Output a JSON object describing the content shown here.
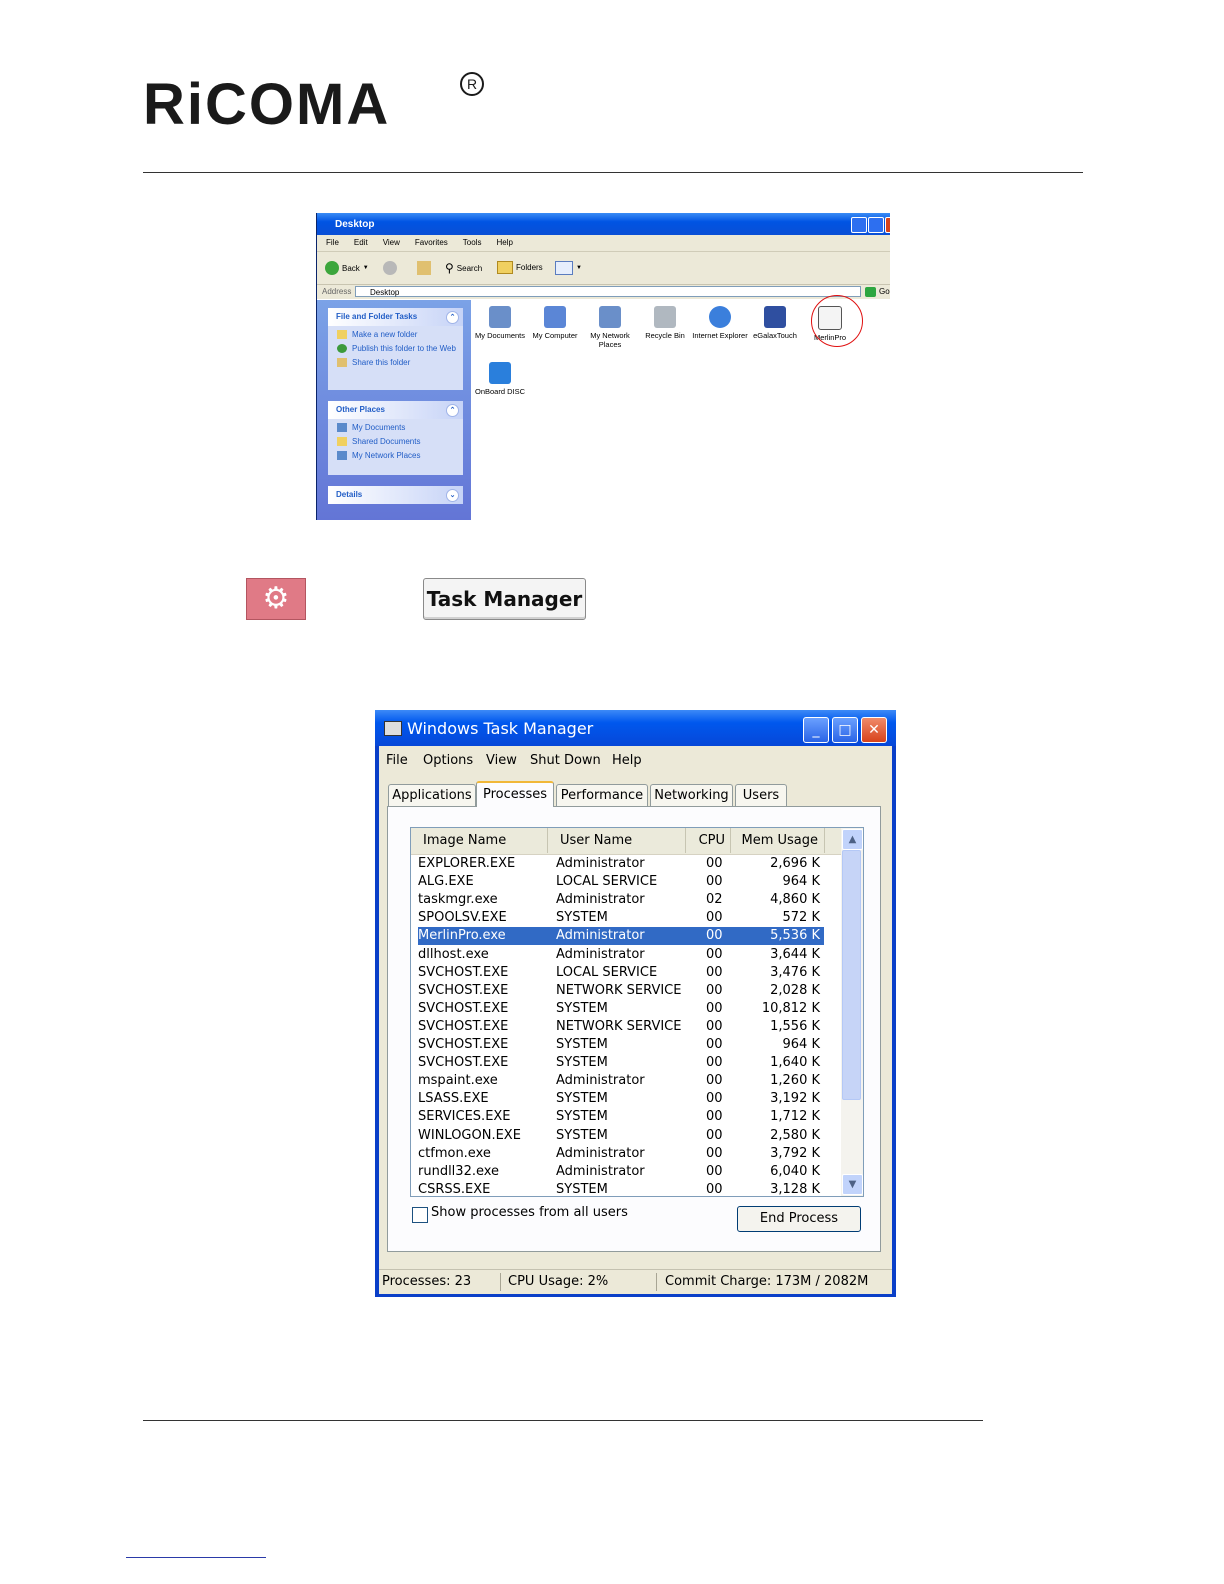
{
  "logo": {
    "text": "RiCOMA",
    "registered": "R"
  },
  "explorer": {
    "title": "Desktop",
    "menu": [
      "File",
      "Edit",
      "View",
      "Favorites",
      "Tools",
      "Help"
    ],
    "toolbar": {
      "back": "Back",
      "search": "Search",
      "folders": "Folders"
    },
    "address_label": "Address",
    "address_value": "Desktop",
    "go_label": "Go",
    "panels": {
      "file_tasks": {
        "title": "File and Folder Tasks",
        "items": [
          "Make a new folder",
          "Publish this folder to the Web",
          "Share this folder"
        ]
      },
      "other_places": {
        "title": "Other Places",
        "items": [
          "My Documents",
          "Shared Documents",
          "My Network Places"
        ]
      },
      "details": {
        "title": "Details"
      }
    },
    "icons": [
      "My Documents",
      "My Computer",
      "My Network Places",
      "Recycle Bin",
      "Internet Explorer",
      "eGalaxTouch",
      "MerlinPro",
      "OnBoard DISC"
    ]
  },
  "task_manager_button": "Task Manager",
  "task_manager": {
    "title": "Windows Task Manager",
    "menu": [
      "File",
      "Options",
      "View",
      "Shut Down",
      "Help"
    ],
    "tabs": [
      "Applications",
      "Processes",
      "Performance",
      "Networking",
      "Users"
    ],
    "active_tab": "Processes",
    "columns": [
      "Image Name",
      "User Name",
      "CPU",
      "Mem Usage"
    ],
    "rows": [
      [
        "EXPLORER.EXE",
        "Administrator",
        "00",
        "2,696 K"
      ],
      [
        "ALG.EXE",
        "LOCAL SERVICE",
        "00",
        "964 K"
      ],
      [
        "taskmgr.exe",
        "Administrator",
        "02",
        "4,860 K"
      ],
      [
        "SPOOLSV.EXE",
        "SYSTEM",
        "00",
        "572 K"
      ],
      [
        "MerlinPro.exe",
        "Administrator",
        "00",
        "5,536 K"
      ],
      [
        "dllhost.exe",
        "Administrator",
        "00",
        "3,644 K"
      ],
      [
        "SVCHOST.EXE",
        "LOCAL SERVICE",
        "00",
        "3,476 K"
      ],
      [
        "SVCHOST.EXE",
        "NETWORK SERVICE",
        "00",
        "2,028 K"
      ],
      [
        "SVCHOST.EXE",
        "SYSTEM",
        "00",
        "10,812 K"
      ],
      [
        "SVCHOST.EXE",
        "NETWORK SERVICE",
        "00",
        "1,556 K"
      ],
      [
        "SVCHOST.EXE",
        "SYSTEM",
        "00",
        "964 K"
      ],
      [
        "SVCHOST.EXE",
        "SYSTEM",
        "00",
        "1,640 K"
      ],
      [
        "mspaint.exe",
        "Administrator",
        "00",
        "1,260 K"
      ],
      [
        "LSASS.EXE",
        "SYSTEM",
        "00",
        "3,192 K"
      ],
      [
        "SERVICES.EXE",
        "SYSTEM",
        "00",
        "1,712 K"
      ],
      [
        "WINLOGON.EXE",
        "SYSTEM",
        "00",
        "2,580 K"
      ],
      [
        "ctfmon.exe",
        "Administrator",
        "00",
        "3,792 K"
      ],
      [
        "rundll32.exe",
        "Administrator",
        "00",
        "6,040 K"
      ],
      [
        "CSRSS.EXE",
        "SYSTEM",
        "00",
        "3,128 K"
      ]
    ],
    "selected_row": 4,
    "show_all_label": "Show processes from all users",
    "end_process_label": "End Process",
    "status": {
      "processes": "Processes: 23",
      "cpu": "CPU Usage: 2%",
      "commit": "Commit Charge: 173M / 2082M"
    }
  }
}
